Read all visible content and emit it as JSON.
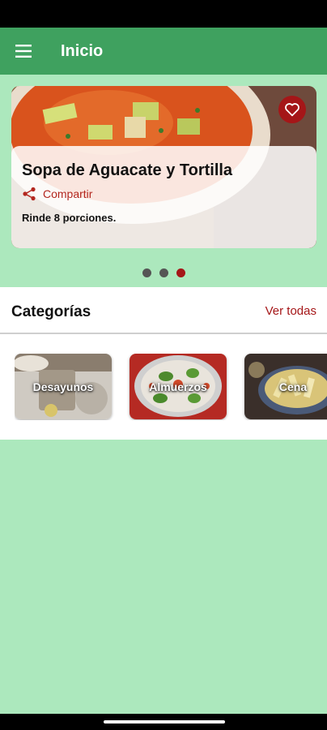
{
  "app_bar": {
    "title": "Inicio"
  },
  "carousel": {
    "recipe_title": "Sopa de Aguacate y Tortilla",
    "share_label": "Compartir",
    "servings": "Rinde 8 porciones.",
    "dots_count": 3,
    "active_dot": 3
  },
  "categories": {
    "title": "Categorías",
    "see_all": "Ver todas",
    "items": [
      {
        "label": "Desayunos"
      },
      {
        "label": "Almuerzos"
      },
      {
        "label": "Cena"
      }
    ]
  },
  "colors": {
    "app_bar": "#3fa15f",
    "background": "#ace8bd",
    "accent_red": "#a51618"
  }
}
